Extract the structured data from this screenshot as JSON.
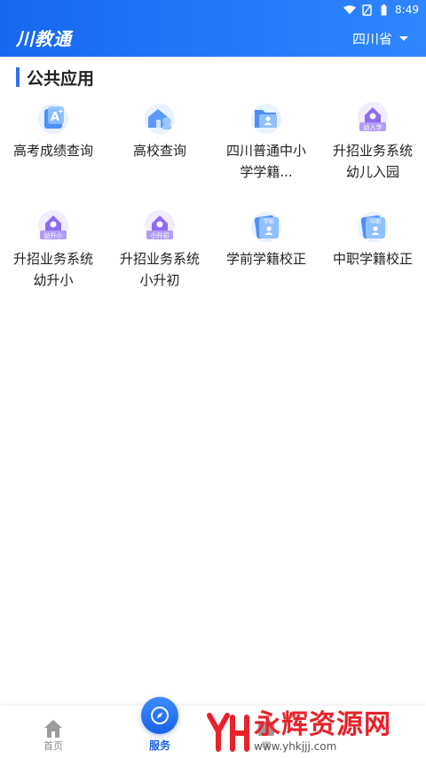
{
  "status_bar": {
    "time": "8:49"
  },
  "header": {
    "logo": "川教通",
    "province": "四川省"
  },
  "section": {
    "title": "公共应用"
  },
  "apps": [
    {
      "label": "高考成绩查询",
      "icon": "exam-score-icon",
      "badge": ""
    },
    {
      "label": "高校查询",
      "icon": "university-icon",
      "badge": ""
    },
    {
      "label": "四川普通中小学学籍...",
      "icon": "folder-person-icon",
      "badge": ""
    },
    {
      "label": "升招业务系统幼儿入园",
      "icon": "house-clock-icon",
      "badge": "幼入学"
    },
    {
      "label": "升招业务系统幼升小",
      "icon": "house-clock-icon",
      "badge": "幼升小"
    },
    {
      "label": "升招业务系统小升初",
      "icon": "house-clock-icon",
      "badge": "小升初"
    },
    {
      "label": "学前学籍校正",
      "icon": "id-card-icon",
      "badge": "学前"
    },
    {
      "label": "中职学籍校正",
      "icon": "id-card-icon",
      "badge": "中职"
    }
  ],
  "tabbar": {
    "items": [
      {
        "label": "首页",
        "icon": "home-icon",
        "active": false
      },
      {
        "label": "服务",
        "icon": "compass-icon",
        "active": true
      },
      {
        "label": "学",
        "icon": "book-icon",
        "active": false
      }
    ]
  },
  "watermark": {
    "brand": "永辉资源网",
    "url": "www.yhkjjj.com"
  },
  "colors": {
    "primary": "#1a62e6",
    "header_start": "#1668f0",
    "header_end": "#2f86ff",
    "purple": "#8e6bf2"
  }
}
